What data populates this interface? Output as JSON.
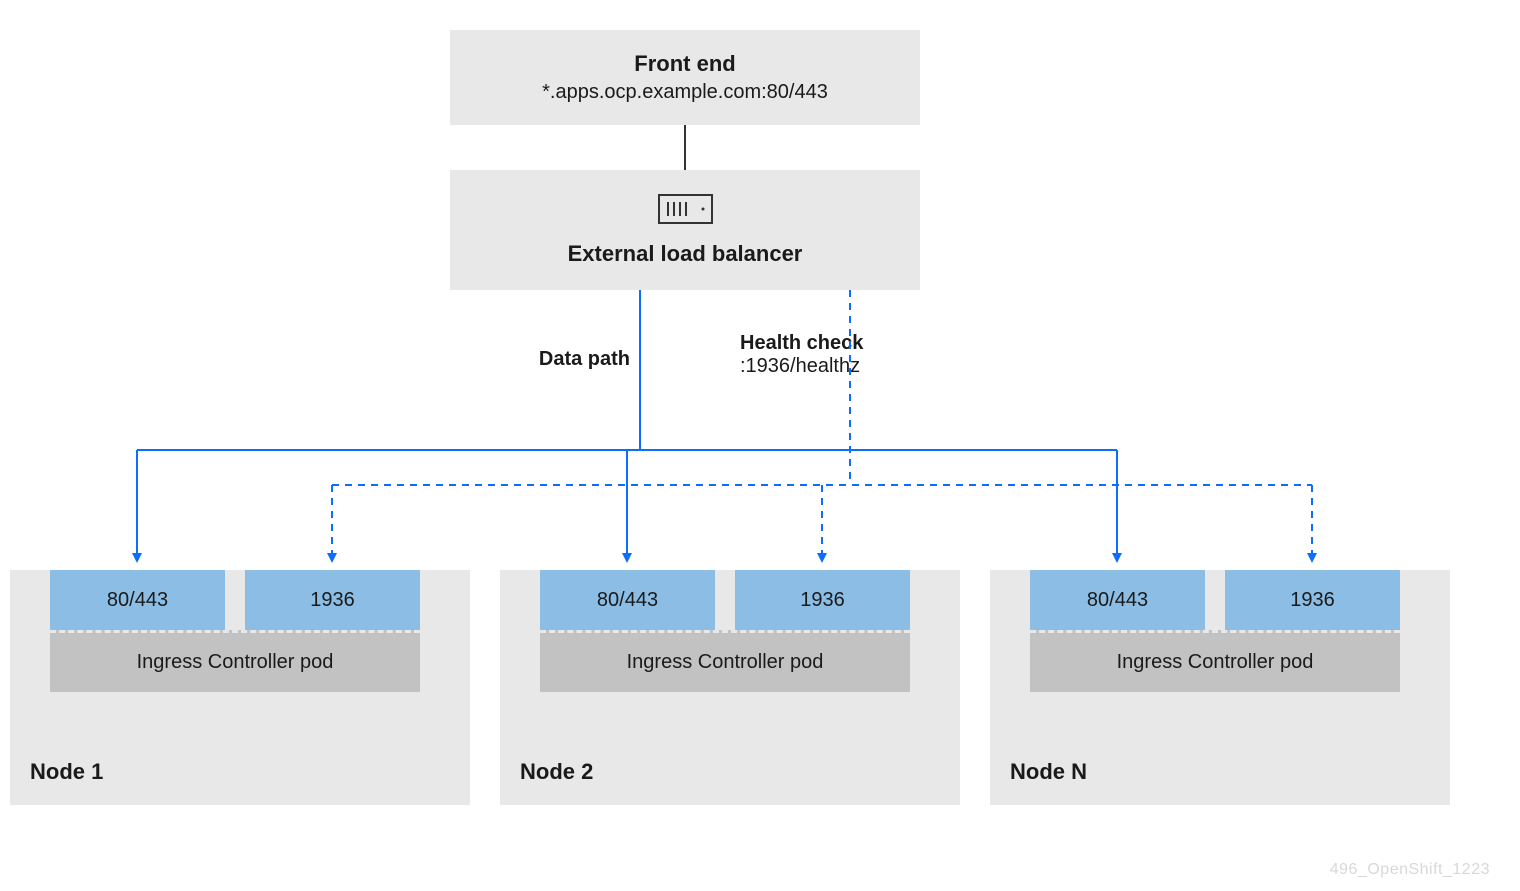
{
  "frontend": {
    "title": "Front end",
    "subtitle": "*.apps.ocp.example.com:80/443"
  },
  "load_balancer": {
    "label": "External load balancer"
  },
  "paths": {
    "data_path": "Data path",
    "health_check_title": "Health check",
    "health_check_sub": ":1936/healthz"
  },
  "nodes": [
    {
      "label": "Node 1",
      "port_left": "80/443",
      "port_right": "1936",
      "pod": "Ingress Controller pod"
    },
    {
      "label": "Node 2",
      "port_left": "80/443",
      "port_right": "1936",
      "pod": "Ingress Controller pod"
    },
    {
      "label": "Node N",
      "port_left": "80/443",
      "port_right": "1936",
      "pod": "Ingress Controller pod"
    }
  ],
  "watermark": "496_OpenShift_1223",
  "colors": {
    "box_light": "#e8e8e8",
    "port_blue": "#8bbde5",
    "pod_gray": "#c2c2c2",
    "line_blue": "#0d6efd"
  }
}
